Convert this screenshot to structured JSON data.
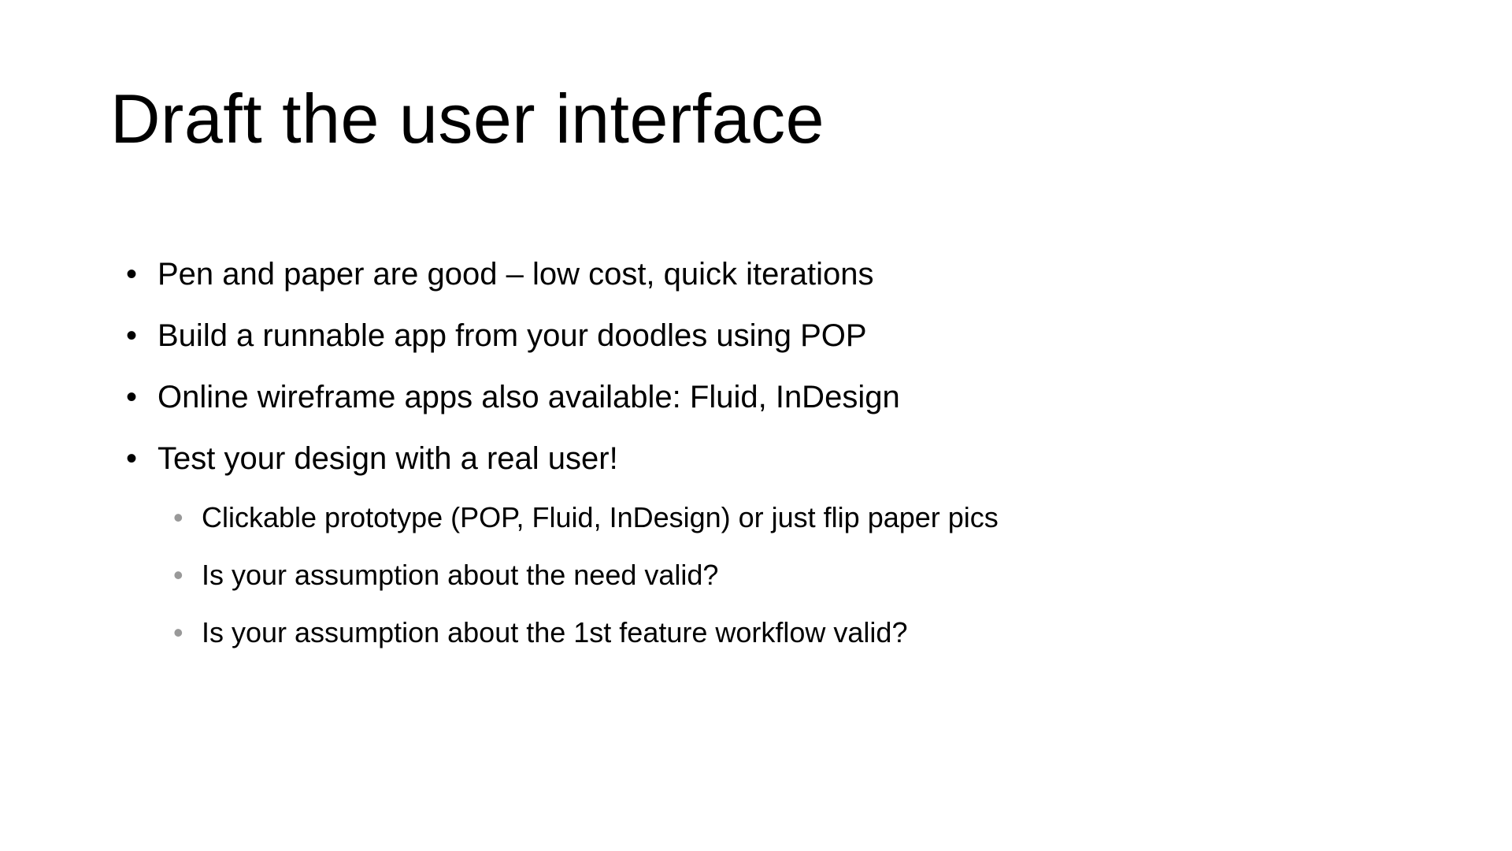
{
  "slide": {
    "title": "Draft the user interface",
    "bullets": [
      "Pen and paper are good – low cost, quick iterations",
      "Build a runnable app from your doodles using POP",
      "Online wireframe apps also available: Fluid, InDesign",
      "Test your design with a real user!"
    ],
    "subBullets": [
      "Clickable prototype (POP, Fluid, InDesign) or just flip paper pics",
      "Is your assumption about the need valid?",
      "Is your assumption about the 1st feature workflow valid?"
    ]
  }
}
